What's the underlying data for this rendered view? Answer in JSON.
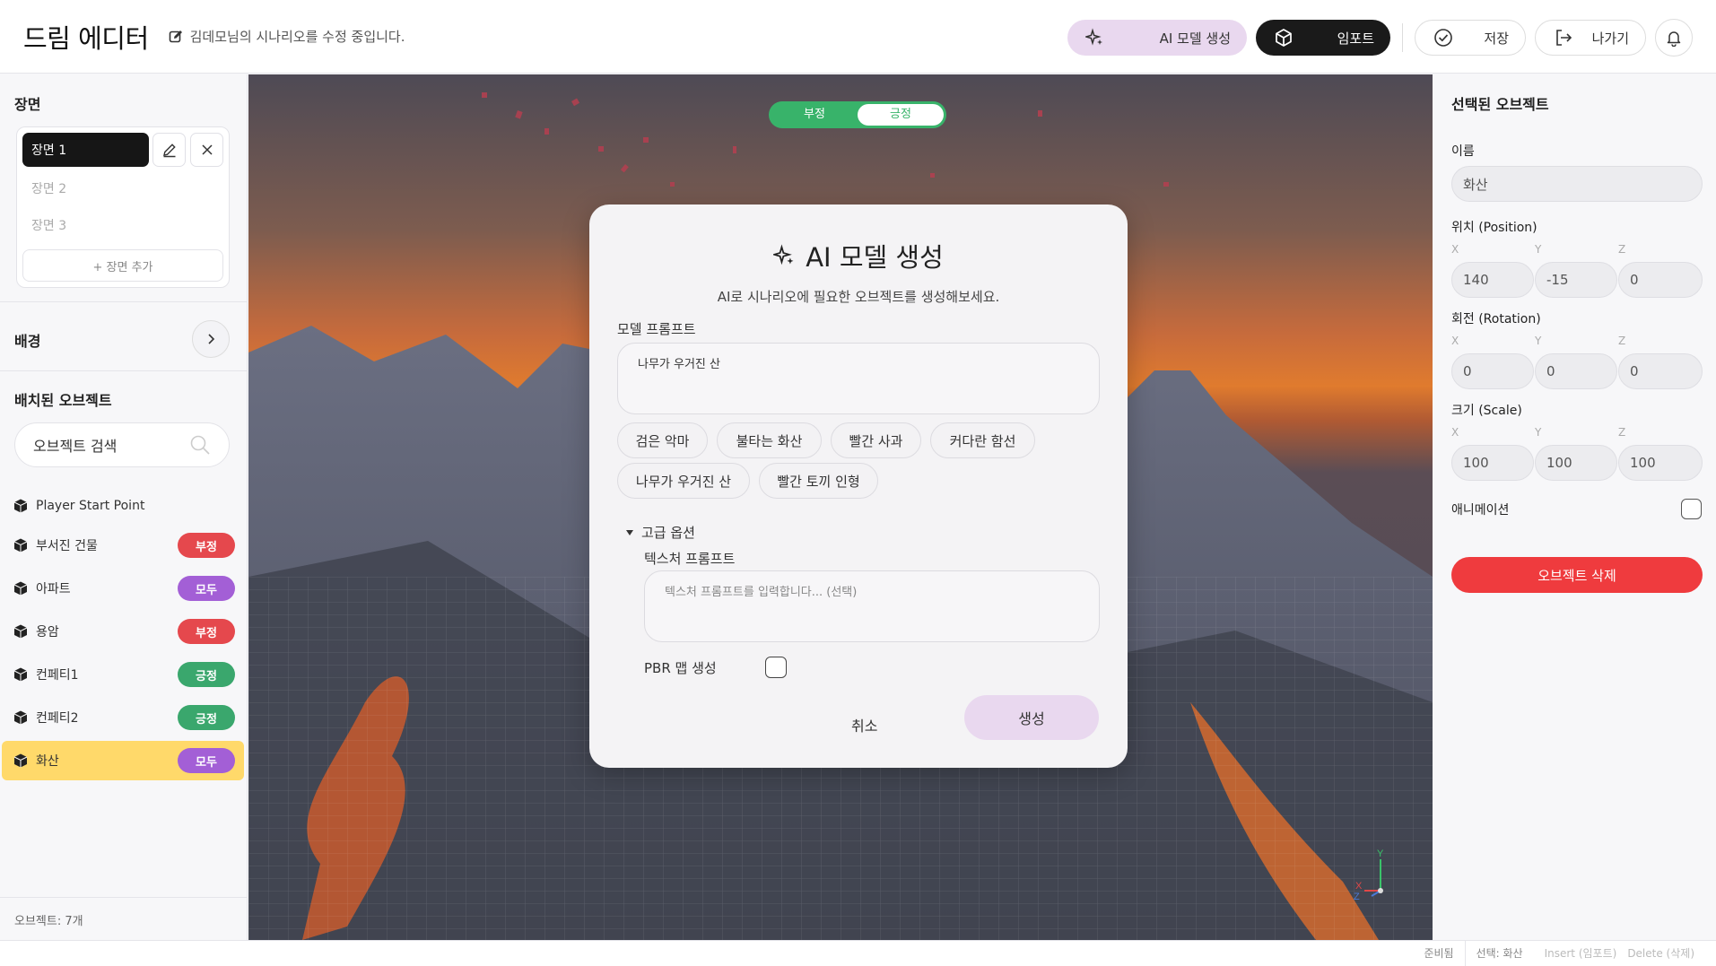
{
  "header": {
    "app_title": "드림 에디터",
    "edit_status": "김데모님의 시나리오를 수정 중입니다.",
    "ai_button": "AI 모델 생성",
    "import_button": "임포트",
    "save_button": "저장",
    "exit_button": "나가기"
  },
  "left": {
    "scenes_title": "장면",
    "scenes": [
      "장면 1",
      "장면 2",
      "장면 3"
    ],
    "add_scene": "+ 장면 추가",
    "background_title": "배경",
    "placed_title": "배치된 오브젝트",
    "search_placeholder": "오브젝트 검색",
    "objects": [
      {
        "name": "Player Start Point",
        "badge": "",
        "badge_color": ""
      },
      {
        "name": "부서진 건물",
        "badge": "부정",
        "badge_color": "#e5484d"
      },
      {
        "name": "아파트",
        "badge": "모두",
        "badge_color": "#a35fd6"
      },
      {
        "name": "용암",
        "badge": "부정",
        "badge_color": "#e5484d"
      },
      {
        "name": "컨페티1",
        "badge": "긍정",
        "badge_color": "#3aa76d"
      },
      {
        "name": "컨페티2",
        "badge": "긍정",
        "badge_color": "#3aa76d"
      },
      {
        "name": "화산",
        "badge": "모두",
        "badge_color": "#a35fd6"
      }
    ],
    "footer": "오브젝트: 7개"
  },
  "viewport": {
    "toggle_negative": "부정",
    "toggle_positive": "긍정",
    "axis_x": "X",
    "axis_y": "Y",
    "axis_z": "Z"
  },
  "modal": {
    "title": "AI 모델 생성",
    "subtitle": "AI로 시나리오에 필요한 오브젝트를 생성해보세요.",
    "prompt_label": "모델 프롬프트",
    "prompt_value": "나무가 우거진 산",
    "suggestions": [
      "검은 악마",
      "불타는 화산",
      "빨간 사과",
      "커다란 함선",
      "나무가 우거진 산",
      "빨간 토끼 인형"
    ],
    "advanced_label": "고급 옵션",
    "texture_label": "텍스처 프롬프트",
    "texture_placeholder": "텍스처 프롬프트를 입력합니다... (선택)",
    "pbr_label": "PBR 맵 생성",
    "cancel": "취소",
    "generate": "생성"
  },
  "right": {
    "title": "선택된 오브젝트",
    "name_label": "이름",
    "name_value": "화산",
    "position_label": "위치 (Position)",
    "rotation_label": "회전 (Rotation)",
    "scale_label": "크기 (Scale)",
    "axes": [
      "X",
      "Y",
      "Z"
    ],
    "position": [
      "140",
      "-15",
      "0"
    ],
    "rotation": [
      "0",
      "0",
      "0"
    ],
    "scale": [
      "100",
      "100",
      "100"
    ],
    "animation_label": "애니메이션",
    "delete_button": "오브젝트 삭제"
  },
  "status": {
    "ready": "준비됨",
    "selection": "선택: 화산",
    "insert_hint": "Insert (임포트)",
    "delete_hint": "Delete (삭제)"
  }
}
